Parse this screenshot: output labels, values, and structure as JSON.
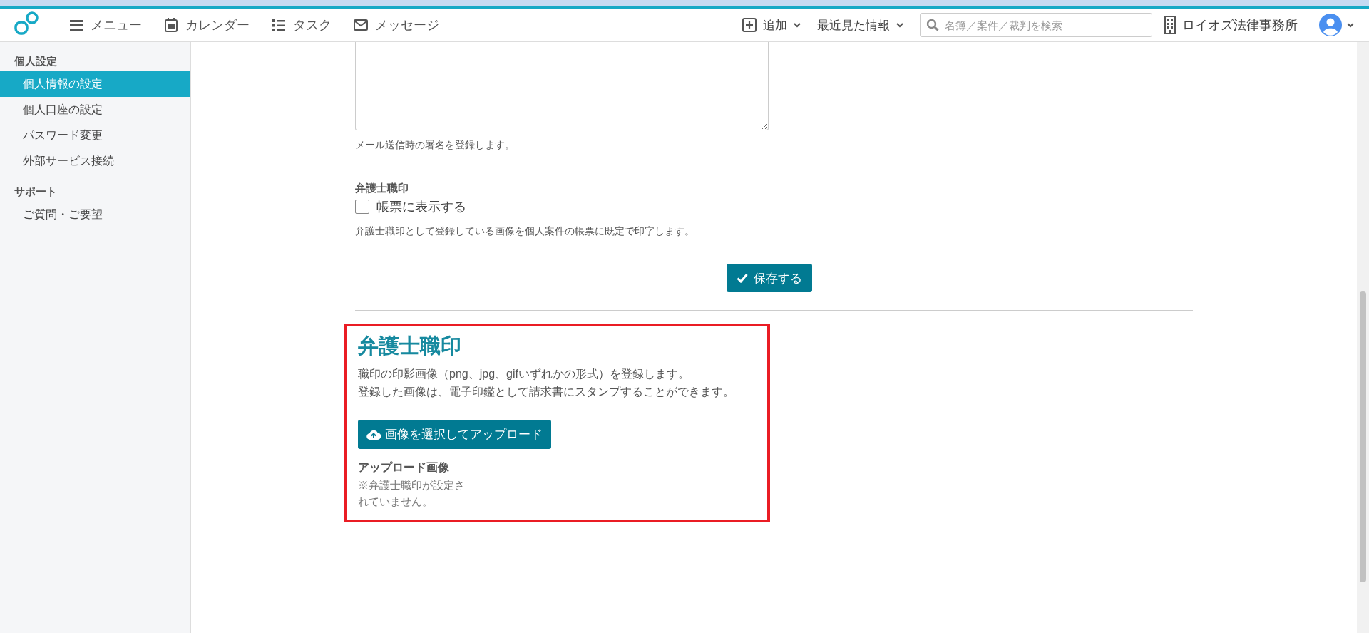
{
  "header": {
    "nav": [
      {
        "label": "メニュー",
        "kind": "menu"
      },
      {
        "label": "カレンダー",
        "kind": "calendar"
      },
      {
        "label": "タスク",
        "kind": "tasks"
      },
      {
        "label": "メッセージ",
        "kind": "mail"
      }
    ],
    "add": "追加",
    "recent": "最近見た情報",
    "search": {
      "placeholder": "名簿／案件／裁判を検索"
    },
    "office": "ロイオズ法律事務所"
  },
  "sidebar": {
    "sections": [
      {
        "title": "個人設定",
        "items": [
          {
            "label": "個人情報の設定",
            "selected": true
          },
          {
            "label": "個人口座の設定",
            "selected": false
          },
          {
            "label": "パスワード変更",
            "selected": false
          },
          {
            "label": "外部サービス接続",
            "selected": false
          }
        ]
      },
      {
        "title": "サポート",
        "items": [
          {
            "label": "ご質問・ご要望",
            "selected": false
          }
        ]
      }
    ]
  },
  "form": {
    "signature_hint": "メール送信時の署名を登録します。",
    "seal_label": "弁護士職印",
    "seal_checkbox": {
      "label": "帳票に表示する",
      "checked": false
    },
    "seal_hint": "弁護士職印として登録している画像を個人案件の帳票に既定で印字します。",
    "save_button": "保存する"
  },
  "seal_section": {
    "highlighted": true,
    "title": "弁護士職印",
    "description": [
      "職印の印影画像（png、jpg、gifいずれかの形式）を登録します。",
      "登録した画像は、電子印鑑として請求書にスタンプすることができます。"
    ],
    "upload_button": "画像を選択してアップロード",
    "uploaded_label": "アップロード画像",
    "empty_message": "※弁護士職印が設定されていません。"
  }
}
